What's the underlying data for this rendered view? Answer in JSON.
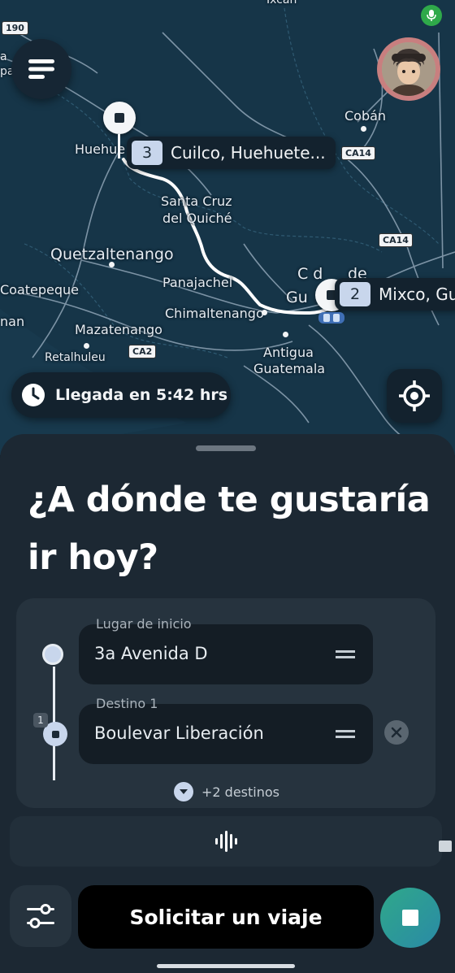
{
  "map": {
    "labels": {
      "ixcan": "Ixcán",
      "coban": "Cobán",
      "huehue": "Huehue",
      "santa_cruz": "Santa Cruz",
      "del_quiche": "del Quiché",
      "quetzaltenango": "Quetzaltenango",
      "panajachel": "Panajachel",
      "coatepeque": "Coatepeque",
      "chimaltenango": "Chimaltenango",
      "mazatenango": "Mazatenango",
      "retalhuleu": "Retalhuleu",
      "antigua": "Antigua",
      "guatemala": "Guatemala",
      "gu": "Gu",
      "cd": "C d",
      "de": "de",
      "nan": "nan",
      "a": "a",
      "pa": "pa"
    },
    "shields": {
      "r190": "190",
      "ca14_a": "CA14",
      "ca14_b": "CA14",
      "ca2": "CA2"
    },
    "waypoints": [
      {
        "number": "3",
        "label": "Cuilco, Huehuete..."
      },
      {
        "number": "2",
        "label": "Mixco, Gu"
      }
    ],
    "eta": "Llegada en 5:42 hrs",
    "colors": {
      "water": "#163548",
      "route": "#ffffff",
      "roads": "#9fb3c4"
    }
  },
  "header": {
    "menu_icon": "menu-icon",
    "avatar_icon": "avatar",
    "mic_icon": "mic-icon"
  },
  "sheet": {
    "headline": "¿A dónde te gustaría ir hoy?",
    "origin": {
      "label": "Lugar de inicio",
      "value": "3a Avenida D"
    },
    "destination": {
      "label": "Destino 1",
      "value": "Boulevar Liberación",
      "index": "1"
    },
    "more_destinations": "+2 destinos",
    "request_button": "Solicitar un viaje"
  },
  "colors": {
    "accent_gradient_start": "#2fa88a",
    "accent_gradient_end": "#2a8aa6",
    "sheet_bg": "#1c2833",
    "field_bg": "#141d25"
  }
}
